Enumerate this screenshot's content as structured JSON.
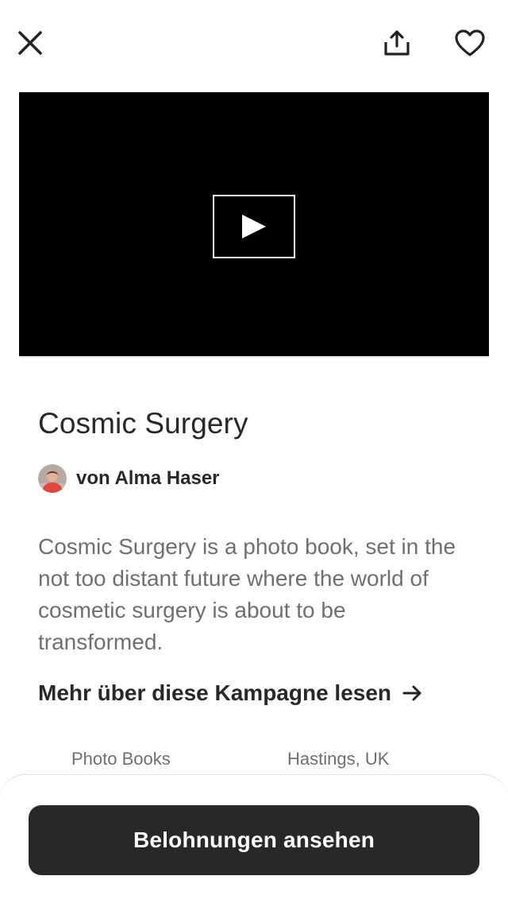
{
  "header": {
    "close_icon": "close-icon",
    "share_icon": "share-icon",
    "favorite_icon": "heart-icon"
  },
  "video": {
    "play_icon": "play-icon",
    "background_color": "#000000"
  },
  "project": {
    "title": "Cosmic Surgery",
    "creator_label": "von Alma Haser",
    "description": "Cosmic Surgery is a photo book, set in the not too distant future where the world of cosmetic surgery is about to be transformed.",
    "read_more": "Mehr über diese Kampagne lesen",
    "category": "Photo Books",
    "location": "Hastings, UK"
  },
  "footer": {
    "cta_label": "Belohnungen ansehen",
    "cta_color": "#282828"
  }
}
